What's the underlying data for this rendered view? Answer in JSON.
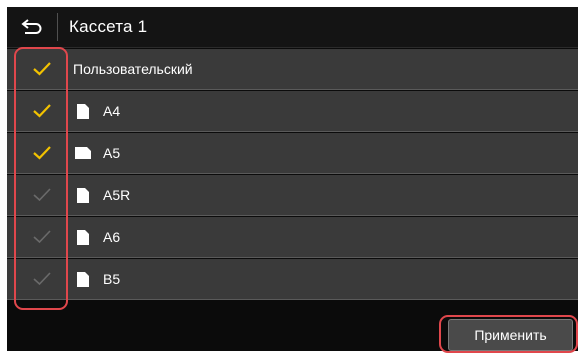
{
  "header": {
    "title": "Кассета 1",
    "back_icon": "return-arrow-icon"
  },
  "items": [
    {
      "label": "Пользовательский",
      "checked": true,
      "paper_icon": ""
    },
    {
      "label": "A4",
      "checked": true,
      "paper_icon": "portrait-paper-icon"
    },
    {
      "label": "A5",
      "checked": true,
      "paper_icon": "landscape-paper-icon"
    },
    {
      "label": "A5R",
      "checked": false,
      "paper_icon": "portrait-paper-icon"
    },
    {
      "label": "A6",
      "checked": false,
      "paper_icon": "portrait-paper-icon"
    },
    {
      "label": "B5",
      "checked": false,
      "paper_icon": "portrait-paper-icon"
    }
  ],
  "footer": {
    "apply_label": "Применить"
  },
  "colors": {
    "check_on": "#f2c200",
    "check_off": "#6a6a6a",
    "highlight": "#e0474c",
    "row_bg": "#3a3a3a"
  }
}
